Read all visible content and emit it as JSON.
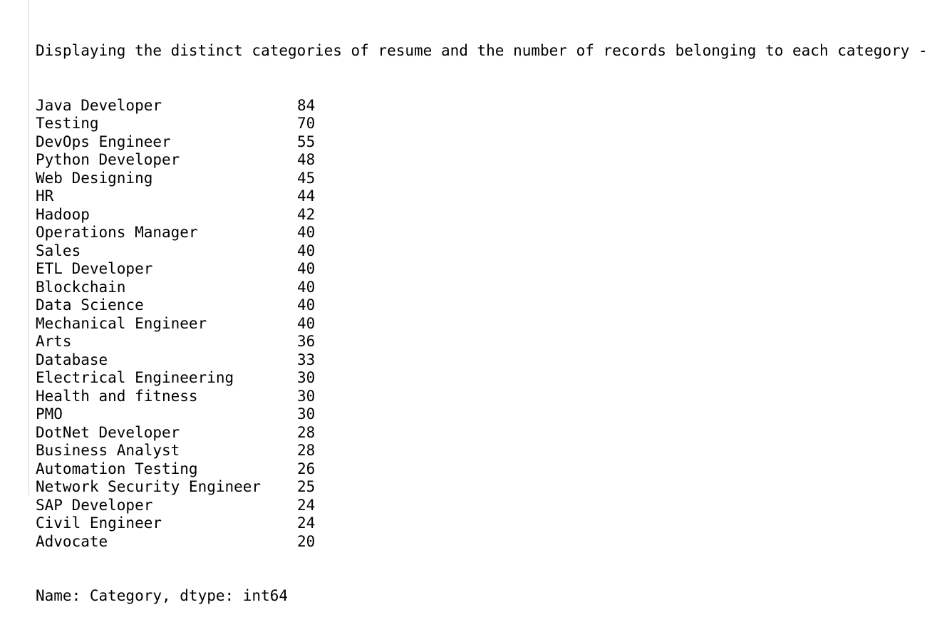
{
  "output": {
    "header": "Displaying the distinct categories of resume and the number of records belonging to each category -",
    "rows": [
      {
        "category": "Java Developer",
        "count": "84"
      },
      {
        "category": "Testing",
        "count": "70"
      },
      {
        "category": "DevOps Engineer",
        "count": "55"
      },
      {
        "category": "Python Developer",
        "count": "48"
      },
      {
        "category": "Web Designing",
        "count": "45"
      },
      {
        "category": "HR",
        "count": "44"
      },
      {
        "category": "Hadoop",
        "count": "42"
      },
      {
        "category": "Operations Manager",
        "count": "40"
      },
      {
        "category": "Sales",
        "count": "40"
      },
      {
        "category": "ETL Developer",
        "count": "40"
      },
      {
        "category": "Blockchain",
        "count": "40"
      },
      {
        "category": "Data Science",
        "count": "40"
      },
      {
        "category": "Mechanical Engineer",
        "count": "40"
      },
      {
        "category": "Arts",
        "count": "36"
      },
      {
        "category": "Database",
        "count": "33"
      },
      {
        "category": "Electrical Engineering",
        "count": "30"
      },
      {
        "category": "Health and fitness",
        "count": "30"
      },
      {
        "category": "PMO",
        "count": "30"
      },
      {
        "category": "DotNet Developer",
        "count": "28"
      },
      {
        "category": "Business Analyst",
        "count": "28"
      },
      {
        "category": "Automation Testing",
        "count": "26"
      },
      {
        "category": "Network Security Engineer",
        "count": "25"
      },
      {
        "category": "SAP Developer",
        "count": "24"
      },
      {
        "category": "Civil Engineer",
        "count": "24"
      },
      {
        "category": "Advocate",
        "count": "20"
      }
    ],
    "footer": "Name: Category, dtype: int64"
  }
}
